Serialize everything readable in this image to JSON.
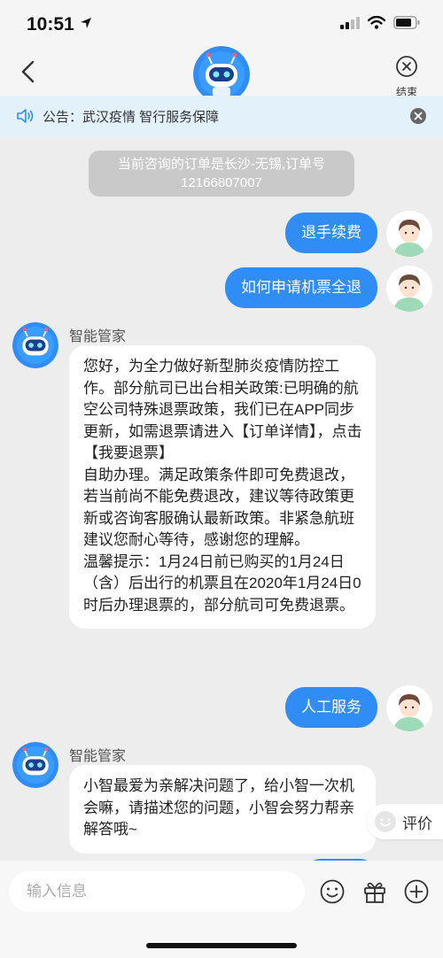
{
  "status_bar": {
    "time": "10:51"
  },
  "header": {
    "end_label": "结束"
  },
  "notice": {
    "text": "公告：武汉疫情 智行服务保障"
  },
  "messages": {
    "system": "当前咨询的订单是长沙-无锡,订单号12166807007",
    "user1": "退手续费",
    "user2": "如何申请机票全退",
    "bot1_name": "智能管家",
    "bot1_lines": [
      "您好，为全力做好新型肺炎疫情防控工作。部分航司已出台相关政策:已明确的航空公司特殊退票政策，我们已在APP同步更新，如需退票请进入【订单详情】，点击【我要退票】",
      "自助办理。满足政策条件即可免费退改，若当前尚不能免费退改，建议等待政策更新或咨询客服确认最新政策。非紧急航班建议您耐心等待，感谢您的理解。",
      "温馨提示：1月24日前已购买的1月24日（含）后出行的机票且在2020年1月24日0时后办理退票的，部分航司可免费退票。"
    ],
    "user3": "人工服务",
    "bot2_name": "智能管家",
    "bot2_text": "小智最爱为亲解决问题了，给小智一次机会嘛，请描述您的问题，小智会努力帮亲解答哦~"
  },
  "rate_button": {
    "label": "评价"
  },
  "input": {
    "placeholder": "输入信息",
    "value": ""
  },
  "colors": {
    "accent": "#2f8df5",
    "notice_bg": "#e3f1fb",
    "system_msg_bg": "#c9c9c9",
    "chat_bg": "#ededed"
  },
  "icons": [
    "back-chevron-icon",
    "robot-avatar-icon",
    "end-close-icon",
    "speaker-icon",
    "close-icon",
    "user-avatar-icon",
    "smiley-icon",
    "gift-icon",
    "plus-icon"
  ]
}
